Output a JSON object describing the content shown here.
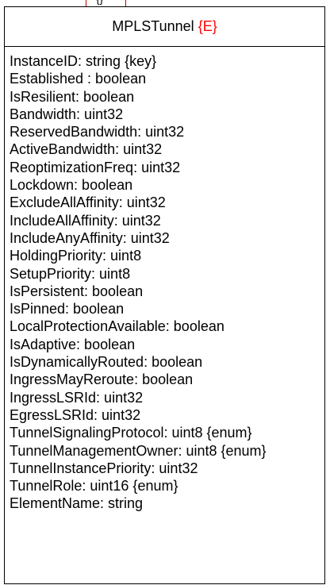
{
  "class": {
    "name": "MPLSTunnel",
    "stereotype": "{E}",
    "attributes": [
      "InstanceID: string {key}",
      "Established : boolean",
      "IsResilient: boolean",
      "Bandwidth: uint32",
      "ReservedBandwidth: uint32",
      "ActiveBandwidth: uint32",
      "ReoptimizationFreq: uint32",
      "Lockdown: boolean",
      "ExcludeAllAffinity: uint32",
      "IncludeAllAffinity: uint32",
      "IncludeAnyAffinity: uint32",
      "HoldingPriority: uint8",
      "SetupPriority: uint8",
      "IsPersistent: boolean",
      "IsPinned: boolean",
      "LocalProtectionAvailable: boolean",
      "IsAdaptive: boolean",
      "IsDynamicallyRouted: boolean",
      "IngressMayReroute: boolean",
      "IngressLSRId: uint32",
      "EgressLSRId: uint32",
      "TunnelSignalingProtocol: uint8 {enum}",
      "TunnelManagementOwner: uint8 {enum}",
      "TunnelInstancePriority: uint32",
      "TunnelRole: uint16 {enum}",
      "ElementName: string"
    ]
  },
  "stub": {
    "mark": "{}"
  },
  "colors": {
    "stereotype": "#ff0000",
    "stub_border": "#c00000",
    "box_border": "#000000"
  }
}
